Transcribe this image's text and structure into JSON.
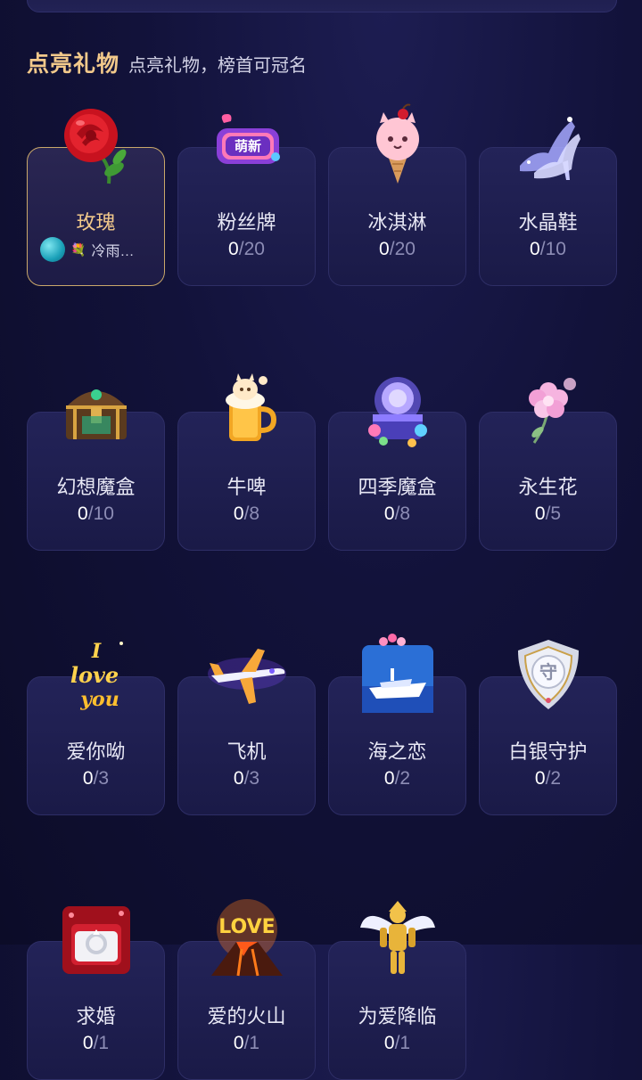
{
  "section": {
    "title": "点亮礼物",
    "subtitle": "点亮礼物，榜首可冠名"
  },
  "gifts": [
    {
      "name": "玫瑰",
      "active": true,
      "holder": {
        "prefix": "💐",
        "name": "冷雨…"
      },
      "icon": "rose-icon"
    },
    {
      "name": "粉丝牌",
      "count": "0",
      "total": "/20",
      "icon": "fan-badge-icon"
    },
    {
      "name": "冰淇淋",
      "count": "0",
      "total": "/20",
      "icon": "ice-cream-icon"
    },
    {
      "name": "水晶鞋",
      "count": "0",
      "total": "/10",
      "icon": "crystal-shoe-icon"
    },
    {
      "name": "幻想魔盒",
      "count": "0",
      "total": "/10",
      "icon": "treasure-chest-icon"
    },
    {
      "name": "牛啤",
      "count": "0",
      "total": "/8",
      "icon": "beer-icon"
    },
    {
      "name": "四季魔盒",
      "count": "0",
      "total": "/8",
      "icon": "magic-box-icon"
    },
    {
      "name": "永生花",
      "count": "0",
      "total": "/5",
      "icon": "flower-icon"
    },
    {
      "name": "爱你呦",
      "count": "0",
      "total": "/3",
      "icon": "i-love-you-icon"
    },
    {
      "name": "飞机",
      "count": "0",
      "total": "/3",
      "icon": "airplane-icon"
    },
    {
      "name": "海之恋",
      "count": "0",
      "total": "/2",
      "icon": "yacht-icon"
    },
    {
      "name": "白银守护",
      "count": "0",
      "total": "/2",
      "icon": "silver-shield-icon"
    },
    {
      "name": "求婚",
      "count": "0",
      "total": "/1",
      "icon": "ring-box-icon"
    },
    {
      "name": "爱的火山",
      "count": "0",
      "total": "/1",
      "icon": "love-volcano-icon"
    },
    {
      "name": "为爱降临",
      "count": "0",
      "total": "/1",
      "icon": "golden-knight-icon"
    }
  ]
}
